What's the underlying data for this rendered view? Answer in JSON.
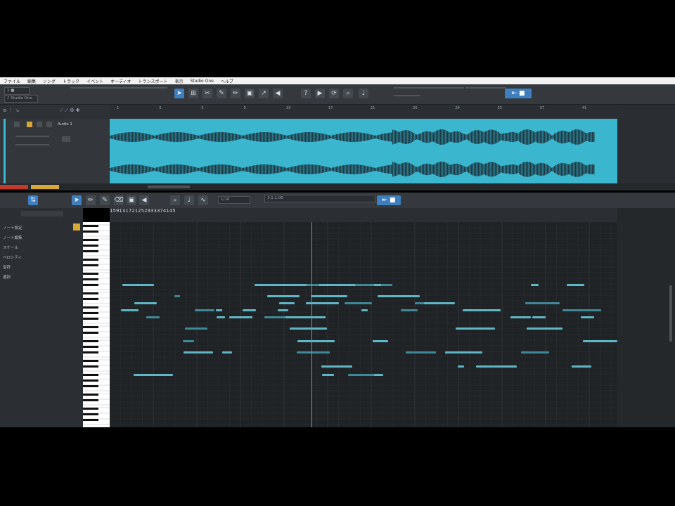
{
  "menu": [
    "ファイル",
    "編集",
    "ソング",
    "トラック",
    "イベント",
    "オーディオ",
    "トランスポート",
    "表示",
    "Studio One",
    "ヘルプ"
  ],
  "arrange_ruler": [
    "1",
    "3",
    "5",
    "9",
    "13",
    "17",
    "21",
    "25",
    "29",
    "33",
    "37",
    "41"
  ],
  "track": {
    "name": "Audio 1",
    "number": "1",
    "volume": "0dB"
  },
  "editor_toolbar": {
    "quantize": "1/16",
    "position": "3.1.1.00"
  },
  "editor_ruler": [
    "1",
    "5",
    "9",
    "13",
    "17",
    "21",
    "25",
    "29",
    "33",
    "37",
    "41",
    "45"
  ],
  "inspector": [
    "ノート設定",
    "ノート編集",
    "スケール",
    "ベロシティ",
    "音符",
    "選択"
  ],
  "colors": {
    "accent": "#3d7fbf",
    "clip": "#3bb6cf",
    "note": "#5fb6c4"
  }
}
